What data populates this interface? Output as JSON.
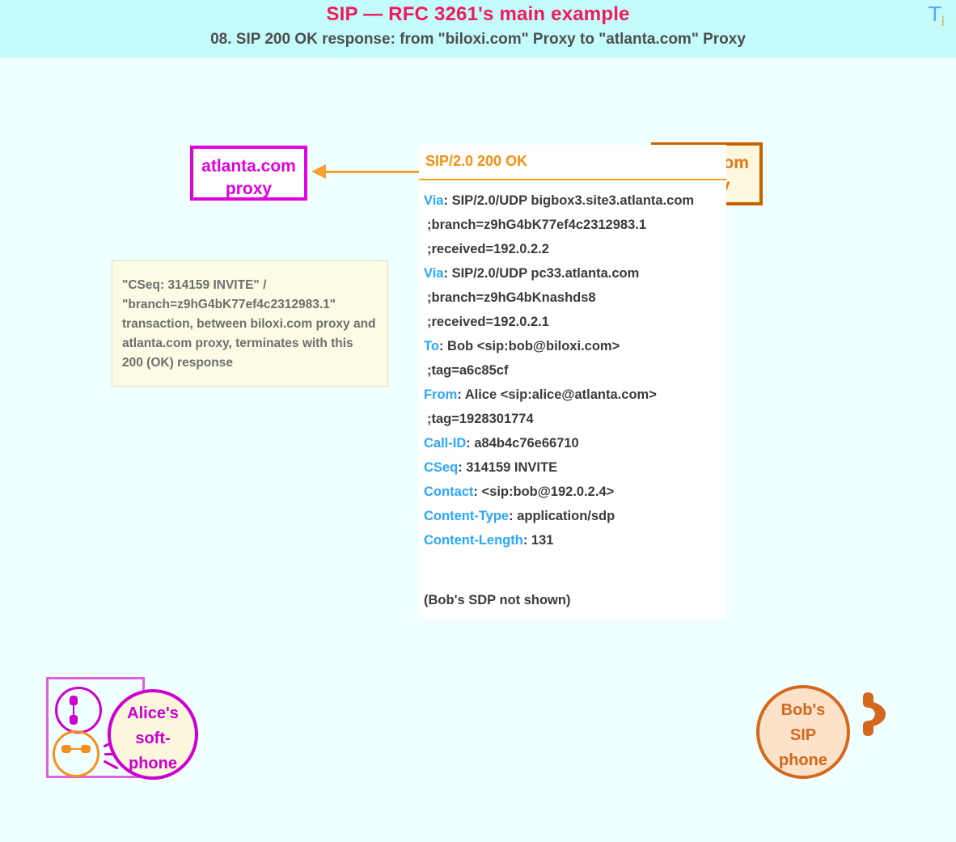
{
  "header": {
    "title": "SIP — RFC 3261's main example",
    "subtitle": "08.  SIP 200 OK response: from \"biloxi.com\" Proxy to \"atlanta.com\" Proxy",
    "logo_main": "T",
    "logo_sub": "i",
    "band_color": "#c4fcfc",
    "title_color": "#f01a5a",
    "subtitle_color": "#4d4d4d"
  },
  "page": {
    "background_color": "#f0ffff"
  },
  "nodes": {
    "atlanta_proxy": {
      "line1": "atlanta.com",
      "line2": "proxy",
      "border_color": "#e000e0",
      "fill_color": "#ffffff",
      "text_color": "#e000e0"
    },
    "biloxi_proxy": {
      "line1": "biloxi.com",
      "line2": "proxy",
      "border_color": "#c86400",
      "fill_color": "#fcf8e0",
      "text_color": "#e07818"
    },
    "alice_phone": {
      "line1": "Alice's",
      "line2": "soft-",
      "line3": "phone",
      "border_color": "#cc00cc",
      "fill_color": "#fcf6dc",
      "text_color": "#cc00cc"
    },
    "bob_phone": {
      "line1": "Bob's",
      "line2": "SIP",
      "line3": "phone",
      "border_color": "#d2691e",
      "fill_color": "#fce2c8",
      "text_color": "#d2691e",
      "handset_glyph": "✆"
    }
  },
  "arrow": {
    "direction": "right-to-left",
    "color": "#f5a030",
    "from": "biloxi.com proxy",
    "to": "atlanta.com proxy"
  },
  "sip_message": {
    "start_line": "SIP/2.0 200 OK",
    "start_line_color": "#f59010",
    "header_name_color": "#29a8ff",
    "header_value_color": "#3a3a3a",
    "lines": [
      {
        "name": "Via",
        "sep": ": ",
        "value": "SIP/2.0/UDP bigbox3.site3.atlanta.com",
        "continuation": false
      },
      {
        "name": "",
        "sep": "",
        "value": ";branch=z9hG4bK77ef4c2312983.1",
        "continuation": true
      },
      {
        "name": "",
        "sep": "",
        "value": ";received=192.0.2.2",
        "continuation": true
      },
      {
        "name": "Via",
        "sep": ": ",
        "value": "SIP/2.0/UDP pc33.atlanta.com",
        "continuation": false
      },
      {
        "name": "",
        "sep": "",
        "value": ";branch=z9hG4bKnashds8",
        "continuation": true
      },
      {
        "name": "",
        "sep": "",
        "value": ";received=192.0.2.1",
        "continuation": true
      },
      {
        "name": "To",
        "sep": ": ",
        "value": "Bob <sip:bob@biloxi.com>",
        "continuation": false
      },
      {
        "name": "",
        "sep": "",
        "value": ";tag=a6c85cf",
        "continuation": true
      },
      {
        "name": "From",
        "sep": ": ",
        "value": "Alice <sip:alice@atlanta.com>",
        "continuation": false
      },
      {
        "name": "",
        "sep": "",
        "value": ";tag=1928301774",
        "continuation": true
      },
      {
        "name": "Call-ID",
        "sep": ": ",
        "value": "a84b4c76e66710",
        "continuation": false
      },
      {
        "name": "CSeq",
        "sep": ": ",
        "value": "314159 INVITE",
        "continuation": false
      },
      {
        "name": "Contact",
        "sep": ": ",
        "value": "<sip:bob@192.0.2.4>",
        "continuation": false
      },
      {
        "name": "Content-Type",
        "sep": ": ",
        "value": "application/sdp",
        "continuation": false
      },
      {
        "name": "Content-Length",
        "sep": ": ",
        "value": "131",
        "continuation": false
      }
    ],
    "body_note": "(Bob's SDP not shown)"
  },
  "annotation": {
    "lines": [
      "\"CSeq: 314159 INVITE\" /",
      "\"branch=z9hG4bK77ef4c2312983.1\"",
      "transaction, between biloxi.com proxy and",
      "atlanta.com proxy, terminates with this",
      "200 (OK) response"
    ],
    "fill_color": "#fcfce4",
    "text_color": "#6e6e6e"
  }
}
